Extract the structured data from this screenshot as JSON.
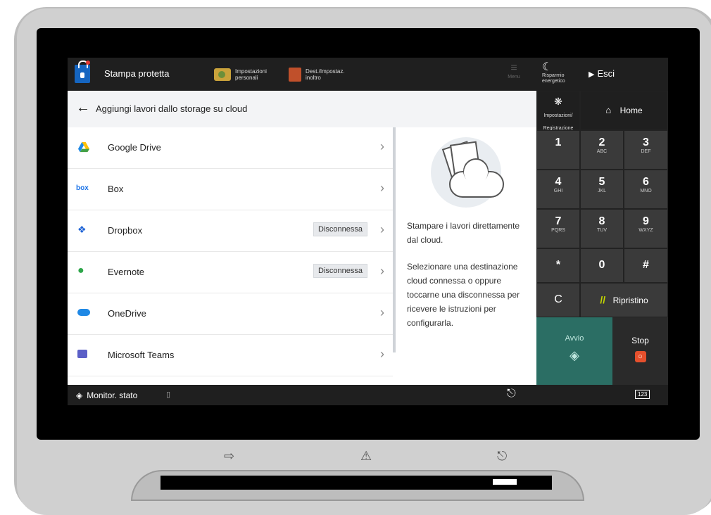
{
  "topbar": {
    "app_title": "Stampa protetta",
    "personal_settings_label": "Impostazioni personali",
    "dest_settings_label": "Dest./Impostaz. inoltro",
    "menu_label": "Menu"
  },
  "right_top": {
    "energy_save_label": "Risparmio energetico",
    "exit_label": "Esci"
  },
  "header": {
    "title": "Aggiungi lavori dallo storage su cloud"
  },
  "services": [
    {
      "label": "Google Drive",
      "icon": "google-drive-icon",
      "badge": ""
    },
    {
      "label": "Box",
      "icon": "box-icon",
      "badge": ""
    },
    {
      "label": "Dropbox",
      "icon": "dropbox-icon",
      "badge": "Disconnessa"
    },
    {
      "label": "Evernote",
      "icon": "evernote-icon",
      "badge": "Disconnessa"
    },
    {
      "label": "OneDrive",
      "icon": "onedrive-icon",
      "badge": ""
    },
    {
      "label": "Microsoft Teams",
      "icon": "teams-icon",
      "badge": ""
    }
  ],
  "info": {
    "line1": "Stampare i lavori direttamente dal cloud.",
    "line2": "Selezionare una destinazione cloud connessa o oppure toccarne una disconnessa per ricevere le istruzioni per configurarla."
  },
  "keypad": {
    "settings_label": "Impostazioni/ Registrazione",
    "home_label": "Home",
    "keys": [
      {
        "n": "1",
        "l": ""
      },
      {
        "n": "2",
        "l": "ABC"
      },
      {
        "n": "3",
        "l": "DEF"
      },
      {
        "n": "4",
        "l": "GHI"
      },
      {
        "n": "5",
        "l": "JKL"
      },
      {
        "n": "6",
        "l": "MNO"
      },
      {
        "n": "7",
        "l": "PQRS"
      },
      {
        "n": "8",
        "l": "TUV"
      },
      {
        "n": "9",
        "l": "WXYZ"
      },
      {
        "n": "*",
        "l": ""
      },
      {
        "n": "0",
        "l": ""
      },
      {
        "n": "#",
        "l": ""
      }
    ],
    "clear_label": "C",
    "reset_label": "Ripristino",
    "start_label": "Avvio",
    "stop_label": "Stop"
  },
  "bottombar": {
    "status_monitor_label": "Monitor. stato",
    "keyboard_label": "123"
  },
  "colors": {
    "accent_teal": "#2b6e64",
    "stop_orange": "#e5502d",
    "lock_blue": "#1565c0"
  }
}
